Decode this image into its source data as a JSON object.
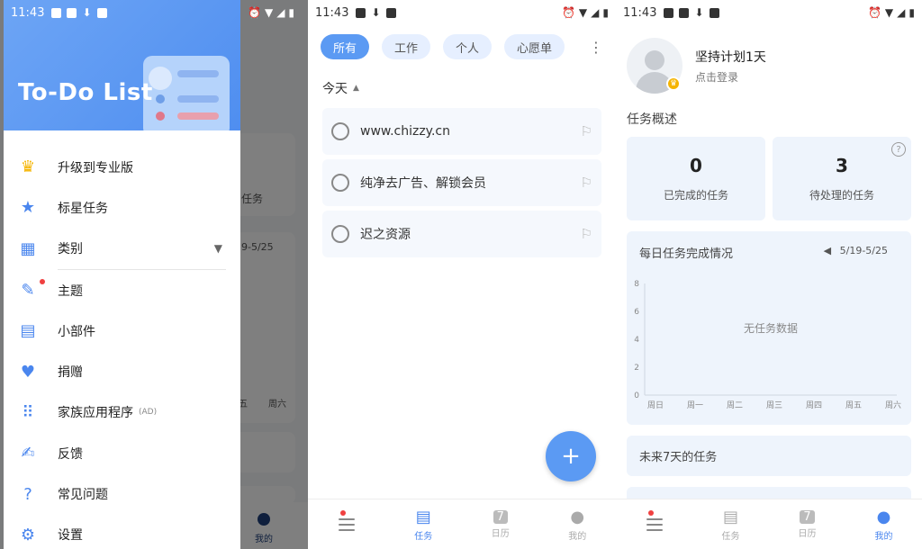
{
  "status": {
    "time": "11:43"
  },
  "drawer": {
    "title": "To-Do List",
    "items": [
      {
        "label": "升级到专业版",
        "icon": "crown-icon"
      },
      {
        "label": "标星任务",
        "icon": "star-icon"
      },
      {
        "label": "类别",
        "icon": "category-icon"
      },
      {
        "label": "主题",
        "icon": "brush-icon"
      },
      {
        "label": "小部件",
        "icon": "widget-icon"
      },
      {
        "label": "捐赠",
        "icon": "heart-icon"
      },
      {
        "label": "家族应用程序",
        "ad": "(AD)",
        "icon": "apps-grid-icon"
      },
      {
        "label": "反馈",
        "icon": "feedback-icon"
      },
      {
        "label": "常见问题",
        "icon": "help-icon"
      },
      {
        "label": "设置",
        "icon": "gear-icon"
      }
    ],
    "underlay": {
      "text1": "任务",
      "text2": "9-5/25",
      "text3": "五",
      "text4": "周六",
      "nav_label": "我的"
    }
  },
  "tasks_screen": {
    "chips": [
      "所有",
      "工作",
      "个人",
      "心愿单"
    ],
    "section": "今天",
    "tasks": [
      "www.chizzy.cn",
      "纯净去广告、解锁会员",
      "迟之资源"
    ],
    "fab": "+",
    "nav": [
      "",
      "任务",
      "日历",
      "我的"
    ],
    "calendar_day": "7"
  },
  "profile_screen": {
    "name": "坚持计划1天",
    "login": "点击登录",
    "overview": "任务概述",
    "completed": {
      "value": "0",
      "label": "已完成的任务"
    },
    "pending": {
      "value": "3",
      "label": "待处理的任务"
    },
    "help_mark": "?",
    "chart_title": "每日任务完成情况",
    "chart_range": "5/19-5/25",
    "future": "未来7天的任务",
    "nav": [
      "",
      "任务",
      "日历",
      "我的"
    ],
    "calendar_day": "7"
  },
  "chart_data": {
    "type": "line",
    "categories": [
      "周日",
      "周一",
      "周二",
      "周三",
      "周四",
      "周五",
      "周六"
    ],
    "series": [],
    "yticks": [
      "0",
      "2",
      "4",
      "6",
      "8"
    ],
    "ylim": [
      0,
      8
    ],
    "empty_text": "无任务数据",
    "grid": false
  },
  "colors": {
    "accent": "#5b9af3",
    "card": "#eef4fc",
    "red_dot": "#f04040",
    "crown": "#f5b400"
  }
}
